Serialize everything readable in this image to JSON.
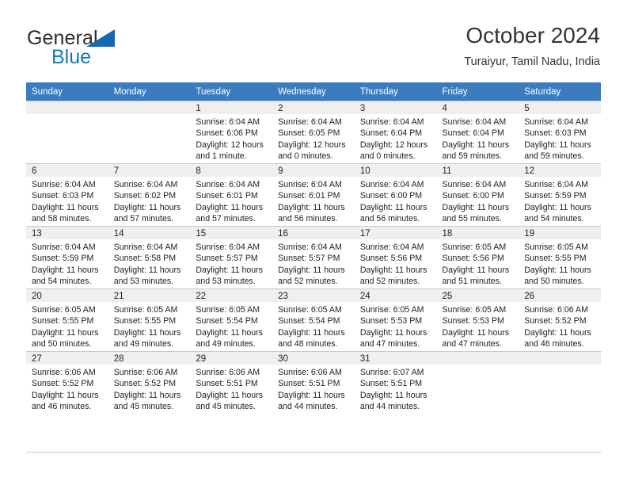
{
  "brand": {
    "name_part1": "General",
    "name_part2": "Blue",
    "logo_icon": "triangle-logo-icon"
  },
  "header": {
    "title": "October 2024",
    "subtitle": "Turaiyur, Tamil Nadu, India"
  },
  "calendar": {
    "accent_color": "#3b7bbf",
    "daynum_bg": "#efefef",
    "grid_line_color": "#c8c8c8",
    "weekday_headers": [
      "Sunday",
      "Monday",
      "Tuesday",
      "Wednesday",
      "Thursday",
      "Friday",
      "Saturday"
    ],
    "weeks": [
      [
        {
          "day": "",
          "empty": true
        },
        {
          "day": "",
          "empty": true
        },
        {
          "day": "1",
          "sunrise": "Sunrise: 6:04 AM",
          "sunset": "Sunset: 6:06 PM",
          "daylight1": "Daylight: 12 hours",
          "daylight2": "and 1 minute."
        },
        {
          "day": "2",
          "sunrise": "Sunrise: 6:04 AM",
          "sunset": "Sunset: 6:05 PM",
          "daylight1": "Daylight: 12 hours",
          "daylight2": "and 0 minutes."
        },
        {
          "day": "3",
          "sunrise": "Sunrise: 6:04 AM",
          "sunset": "Sunset: 6:04 PM",
          "daylight1": "Daylight: 12 hours",
          "daylight2": "and 0 minutes."
        },
        {
          "day": "4",
          "sunrise": "Sunrise: 6:04 AM",
          "sunset": "Sunset: 6:04 PM",
          "daylight1": "Daylight: 11 hours",
          "daylight2": "and 59 minutes."
        },
        {
          "day": "5",
          "sunrise": "Sunrise: 6:04 AM",
          "sunset": "Sunset: 6:03 PM",
          "daylight1": "Daylight: 11 hours",
          "daylight2": "and 59 minutes."
        }
      ],
      [
        {
          "day": "6",
          "sunrise": "Sunrise: 6:04 AM",
          "sunset": "Sunset: 6:03 PM",
          "daylight1": "Daylight: 11 hours",
          "daylight2": "and 58 minutes."
        },
        {
          "day": "7",
          "sunrise": "Sunrise: 6:04 AM",
          "sunset": "Sunset: 6:02 PM",
          "daylight1": "Daylight: 11 hours",
          "daylight2": "and 57 minutes."
        },
        {
          "day": "8",
          "sunrise": "Sunrise: 6:04 AM",
          "sunset": "Sunset: 6:01 PM",
          "daylight1": "Daylight: 11 hours",
          "daylight2": "and 57 minutes."
        },
        {
          "day": "9",
          "sunrise": "Sunrise: 6:04 AM",
          "sunset": "Sunset: 6:01 PM",
          "daylight1": "Daylight: 11 hours",
          "daylight2": "and 56 minutes."
        },
        {
          "day": "10",
          "sunrise": "Sunrise: 6:04 AM",
          "sunset": "Sunset: 6:00 PM",
          "daylight1": "Daylight: 11 hours",
          "daylight2": "and 56 minutes."
        },
        {
          "day": "11",
          "sunrise": "Sunrise: 6:04 AM",
          "sunset": "Sunset: 6:00 PM",
          "daylight1": "Daylight: 11 hours",
          "daylight2": "and 55 minutes."
        },
        {
          "day": "12",
          "sunrise": "Sunrise: 6:04 AM",
          "sunset": "Sunset: 5:59 PM",
          "daylight1": "Daylight: 11 hours",
          "daylight2": "and 54 minutes."
        }
      ],
      [
        {
          "day": "13",
          "sunrise": "Sunrise: 6:04 AM",
          "sunset": "Sunset: 5:59 PM",
          "daylight1": "Daylight: 11 hours",
          "daylight2": "and 54 minutes."
        },
        {
          "day": "14",
          "sunrise": "Sunrise: 6:04 AM",
          "sunset": "Sunset: 5:58 PM",
          "daylight1": "Daylight: 11 hours",
          "daylight2": "and 53 minutes."
        },
        {
          "day": "15",
          "sunrise": "Sunrise: 6:04 AM",
          "sunset": "Sunset: 5:57 PM",
          "daylight1": "Daylight: 11 hours",
          "daylight2": "and 53 minutes."
        },
        {
          "day": "16",
          "sunrise": "Sunrise: 6:04 AM",
          "sunset": "Sunset: 5:57 PM",
          "daylight1": "Daylight: 11 hours",
          "daylight2": "and 52 minutes."
        },
        {
          "day": "17",
          "sunrise": "Sunrise: 6:04 AM",
          "sunset": "Sunset: 5:56 PM",
          "daylight1": "Daylight: 11 hours",
          "daylight2": "and 52 minutes."
        },
        {
          "day": "18",
          "sunrise": "Sunrise: 6:05 AM",
          "sunset": "Sunset: 5:56 PM",
          "daylight1": "Daylight: 11 hours",
          "daylight2": "and 51 minutes."
        },
        {
          "day": "19",
          "sunrise": "Sunrise: 6:05 AM",
          "sunset": "Sunset: 5:55 PM",
          "daylight1": "Daylight: 11 hours",
          "daylight2": "and 50 minutes."
        }
      ],
      [
        {
          "day": "20",
          "sunrise": "Sunrise: 6:05 AM",
          "sunset": "Sunset: 5:55 PM",
          "daylight1": "Daylight: 11 hours",
          "daylight2": "and 50 minutes."
        },
        {
          "day": "21",
          "sunrise": "Sunrise: 6:05 AM",
          "sunset": "Sunset: 5:55 PM",
          "daylight1": "Daylight: 11 hours",
          "daylight2": "and 49 minutes."
        },
        {
          "day": "22",
          "sunrise": "Sunrise: 6:05 AM",
          "sunset": "Sunset: 5:54 PM",
          "daylight1": "Daylight: 11 hours",
          "daylight2": "and 49 minutes."
        },
        {
          "day": "23",
          "sunrise": "Sunrise: 6:05 AM",
          "sunset": "Sunset: 5:54 PM",
          "daylight1": "Daylight: 11 hours",
          "daylight2": "and 48 minutes."
        },
        {
          "day": "24",
          "sunrise": "Sunrise: 6:05 AM",
          "sunset": "Sunset: 5:53 PM",
          "daylight1": "Daylight: 11 hours",
          "daylight2": "and 47 minutes."
        },
        {
          "day": "25",
          "sunrise": "Sunrise: 6:05 AM",
          "sunset": "Sunset: 5:53 PM",
          "daylight1": "Daylight: 11 hours",
          "daylight2": "and 47 minutes."
        },
        {
          "day": "26",
          "sunrise": "Sunrise: 6:06 AM",
          "sunset": "Sunset: 5:52 PM",
          "daylight1": "Daylight: 11 hours",
          "daylight2": "and 46 minutes."
        }
      ],
      [
        {
          "day": "27",
          "sunrise": "Sunrise: 6:06 AM",
          "sunset": "Sunset: 5:52 PM",
          "daylight1": "Daylight: 11 hours",
          "daylight2": "and 46 minutes."
        },
        {
          "day": "28",
          "sunrise": "Sunrise: 6:06 AM",
          "sunset": "Sunset: 5:52 PM",
          "daylight1": "Daylight: 11 hours",
          "daylight2": "and 45 minutes."
        },
        {
          "day": "29",
          "sunrise": "Sunrise: 6:06 AM",
          "sunset": "Sunset: 5:51 PM",
          "daylight1": "Daylight: 11 hours",
          "daylight2": "and 45 minutes."
        },
        {
          "day": "30",
          "sunrise": "Sunrise: 6:06 AM",
          "sunset": "Sunset: 5:51 PM",
          "daylight1": "Daylight: 11 hours",
          "daylight2": "and 44 minutes."
        },
        {
          "day": "31",
          "sunrise": "Sunrise: 6:07 AM",
          "sunset": "Sunset: 5:51 PM",
          "daylight1": "Daylight: 11 hours",
          "daylight2": "and 44 minutes."
        },
        {
          "day": "",
          "empty": true
        },
        {
          "day": "",
          "empty": true
        }
      ]
    ]
  }
}
